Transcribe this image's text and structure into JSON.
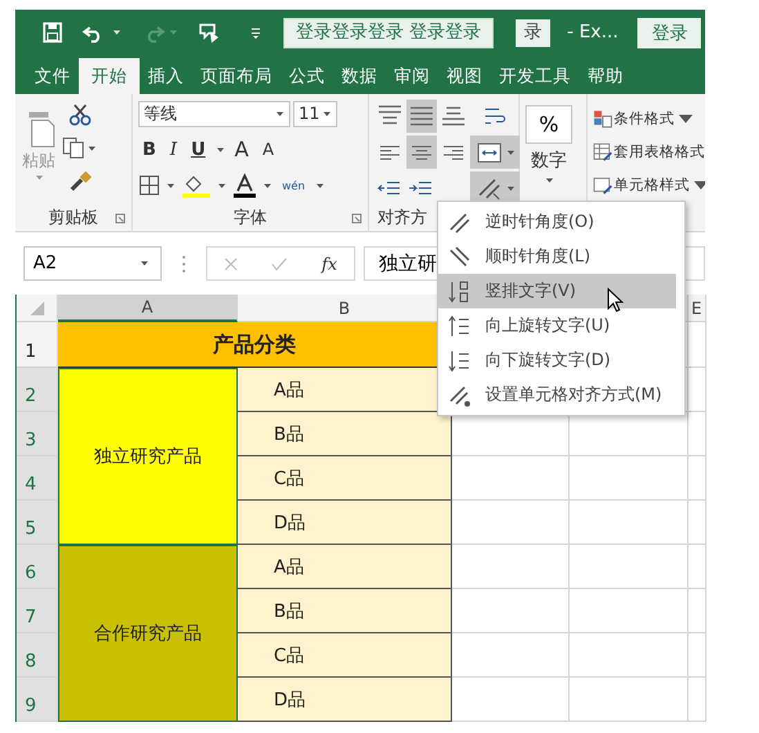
{
  "title_bar": {
    "search_box": "登录登录登录 登录登录",
    "file_box": "录",
    "app_name": "- Ex...",
    "login_button": "登录"
  },
  "tabs": [
    {
      "label": "文件",
      "selected": false
    },
    {
      "label": "开始",
      "selected": true
    },
    {
      "label": "插入",
      "selected": false
    },
    {
      "label": "页面布局",
      "selected": false
    },
    {
      "label": "公式",
      "selected": false
    },
    {
      "label": "数据",
      "selected": false
    },
    {
      "label": "审阅",
      "selected": false
    },
    {
      "label": "视图",
      "selected": false
    },
    {
      "label": "开发工具",
      "selected": false
    },
    {
      "label": "帮助",
      "selected": false
    }
  ],
  "ribbon": {
    "clipboard": {
      "paste": "粘贴",
      "label": "剪贴板"
    },
    "font": {
      "font_name": "等线",
      "font_size": "11",
      "bold": "B",
      "italic": "I",
      "underline": "U",
      "grow": "A",
      "shrink": "A",
      "phonetic": "wén",
      "label": "字体"
    },
    "alignment": {
      "label": "对齐方",
      "buttons": [
        {
          "kind": "top",
          "selected": false
        },
        {
          "kind": "middle",
          "selected": true
        },
        {
          "kind": "bottom",
          "selected": false
        },
        {
          "kind": "wrap",
          "selected": false
        },
        {
          "kind": "left",
          "selected": false
        },
        {
          "kind": "center",
          "selected": true
        },
        {
          "kind": "right",
          "selected": false
        },
        {
          "kind": "merge",
          "selected": true
        },
        {
          "kind": "outdent",
          "selected": false
        },
        {
          "kind": "indent",
          "selected": false
        },
        {
          "kind": "orientation",
          "selected": true
        }
      ]
    },
    "number": {
      "percent": "%",
      "label": "数字"
    },
    "styles": [
      "条件格式",
      "套用表格格式",
      "单元格样式"
    ]
  },
  "formula_bar": {
    "name_box": "A2",
    "function_label": "fx",
    "content": "独立研"
  },
  "sheet": {
    "columns": [
      {
        "label": "A",
        "selected": true
      },
      {
        "label": "B",
        "selected": false
      },
      {
        "label": "E",
        "selected": false
      }
    ],
    "rows": [
      {
        "label": "1",
        "selected": false
      },
      {
        "label": "2",
        "selected": true
      },
      {
        "label": "3",
        "selected": true
      },
      {
        "label": "4",
        "selected": true
      },
      {
        "label": "5",
        "selected": true
      },
      {
        "label": "6",
        "selected": true
      },
      {
        "label": "7",
        "selected": true
      },
      {
        "label": "8",
        "selected": true
      },
      {
        "label": "9",
        "selected": true
      }
    ],
    "header_cell": "产品分类",
    "groups": [
      {
        "name": "独立研究产品",
        "color": "#ffff00",
        "items": [
          "A品",
          "B品",
          "C品",
          "D品"
        ]
      },
      {
        "name": "合作研究产品",
        "color": "#c8c000",
        "items": [
          "A品",
          "B品",
          "C品",
          "D品"
        ]
      }
    ]
  },
  "menu": {
    "items": [
      {
        "label": "逆时针角度(O)",
        "selected": false
      },
      {
        "label": "顺时针角度(L)",
        "selected": false
      },
      {
        "label": "竖排文字(V)",
        "selected": true
      },
      {
        "label": "向上旋转文字(U)",
        "selected": false
      },
      {
        "label": "向下旋转文字(D)",
        "selected": false
      },
      {
        "label": "设置单元格对齐方式(M)",
        "selected": false
      }
    ]
  }
}
